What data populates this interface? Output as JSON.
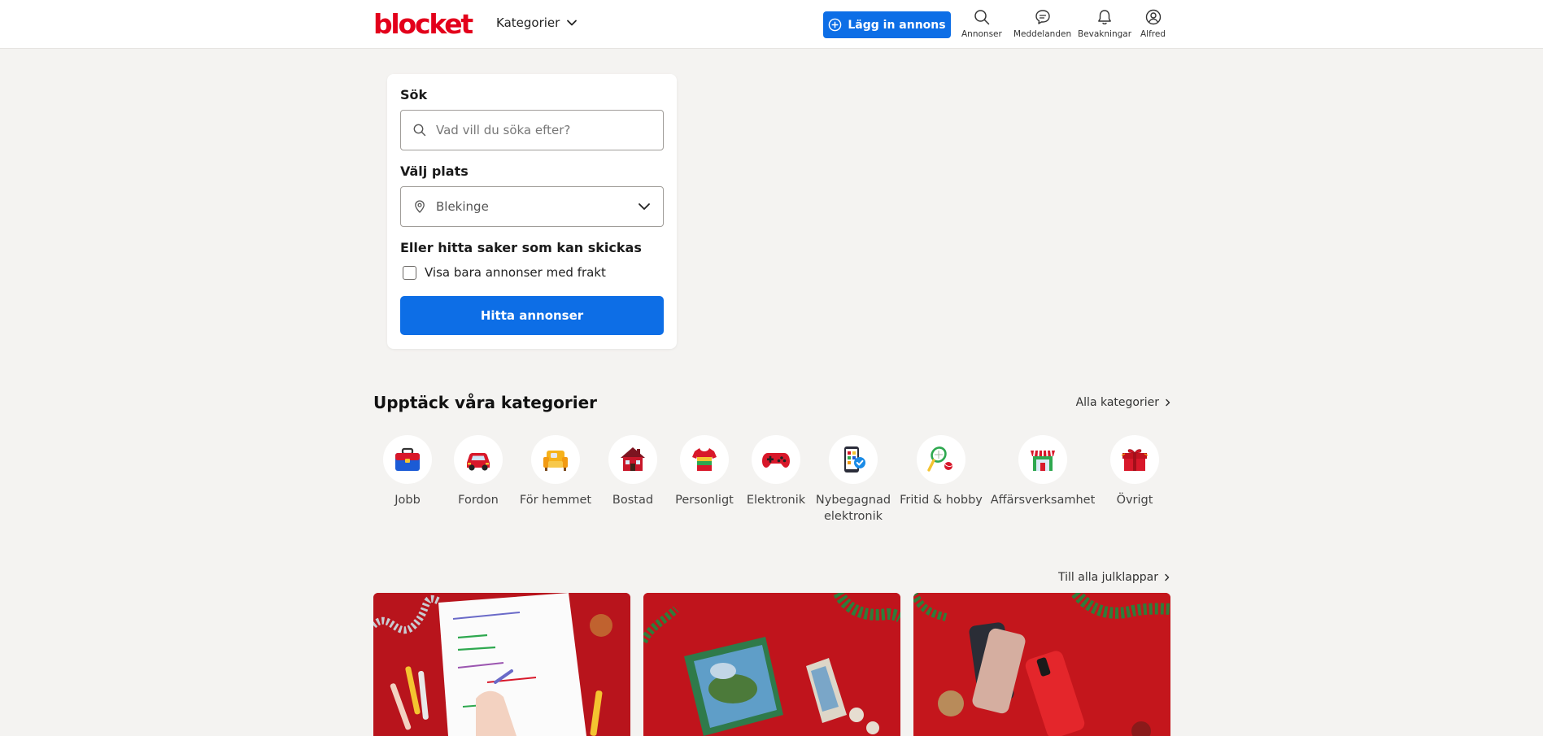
{
  "header": {
    "logo": "blocket",
    "categories_menu": "Kategorier",
    "post_button": "Lägg in annons",
    "nav": [
      {
        "label": "Annonser",
        "icon": "search-icon"
      },
      {
        "label": "Meddelanden",
        "icon": "chat-icon"
      },
      {
        "label": "Bevakningar",
        "icon": "bell-icon"
      },
      {
        "label": "Alfred",
        "icon": "user-icon"
      }
    ]
  },
  "search": {
    "label": "Sök",
    "placeholder": "Vad vill du söka efter?",
    "location_label": "Välj plats",
    "location_value": "Blekinge",
    "shipping_heading": "Eller hitta saker som kan skickas",
    "shipping_checkbox": "Visa bara annonser med frakt",
    "shipping_checked": false,
    "submit": "Hitta annonser"
  },
  "categories": {
    "title": "Upptäck våra kategorier",
    "all_link": "Alla kategorier",
    "items": [
      {
        "label": "Jobb",
        "icon": "briefcase-icon"
      },
      {
        "label": "Fordon",
        "icon": "car-icon"
      },
      {
        "label": "För hemmet",
        "icon": "armchair-icon"
      },
      {
        "label": "Bostad",
        "icon": "house-icon"
      },
      {
        "label": "Personligt",
        "icon": "shirt-icon"
      },
      {
        "label": "Elektronik",
        "icon": "gamepad-icon"
      },
      {
        "label": "Nybegagnad elektronik",
        "icon": "phone-verified-icon"
      },
      {
        "label": "Fritid & hobby",
        "icon": "tennis-icon"
      },
      {
        "label": "Affärsverksamhet",
        "icon": "shop-icon"
      },
      {
        "label": "Övrigt",
        "icon": "gift-box-icon"
      }
    ]
  },
  "gifts": {
    "link": "Till alla julklappar",
    "cards": [
      {
        "image": "wishlist-image"
      },
      {
        "image": "puzzle-image"
      },
      {
        "image": "phones-image"
      }
    ]
  },
  "colors": {
    "brand_red": "#e3001b",
    "primary_blue": "#0d6ee6",
    "background": "#f4f3f1"
  }
}
